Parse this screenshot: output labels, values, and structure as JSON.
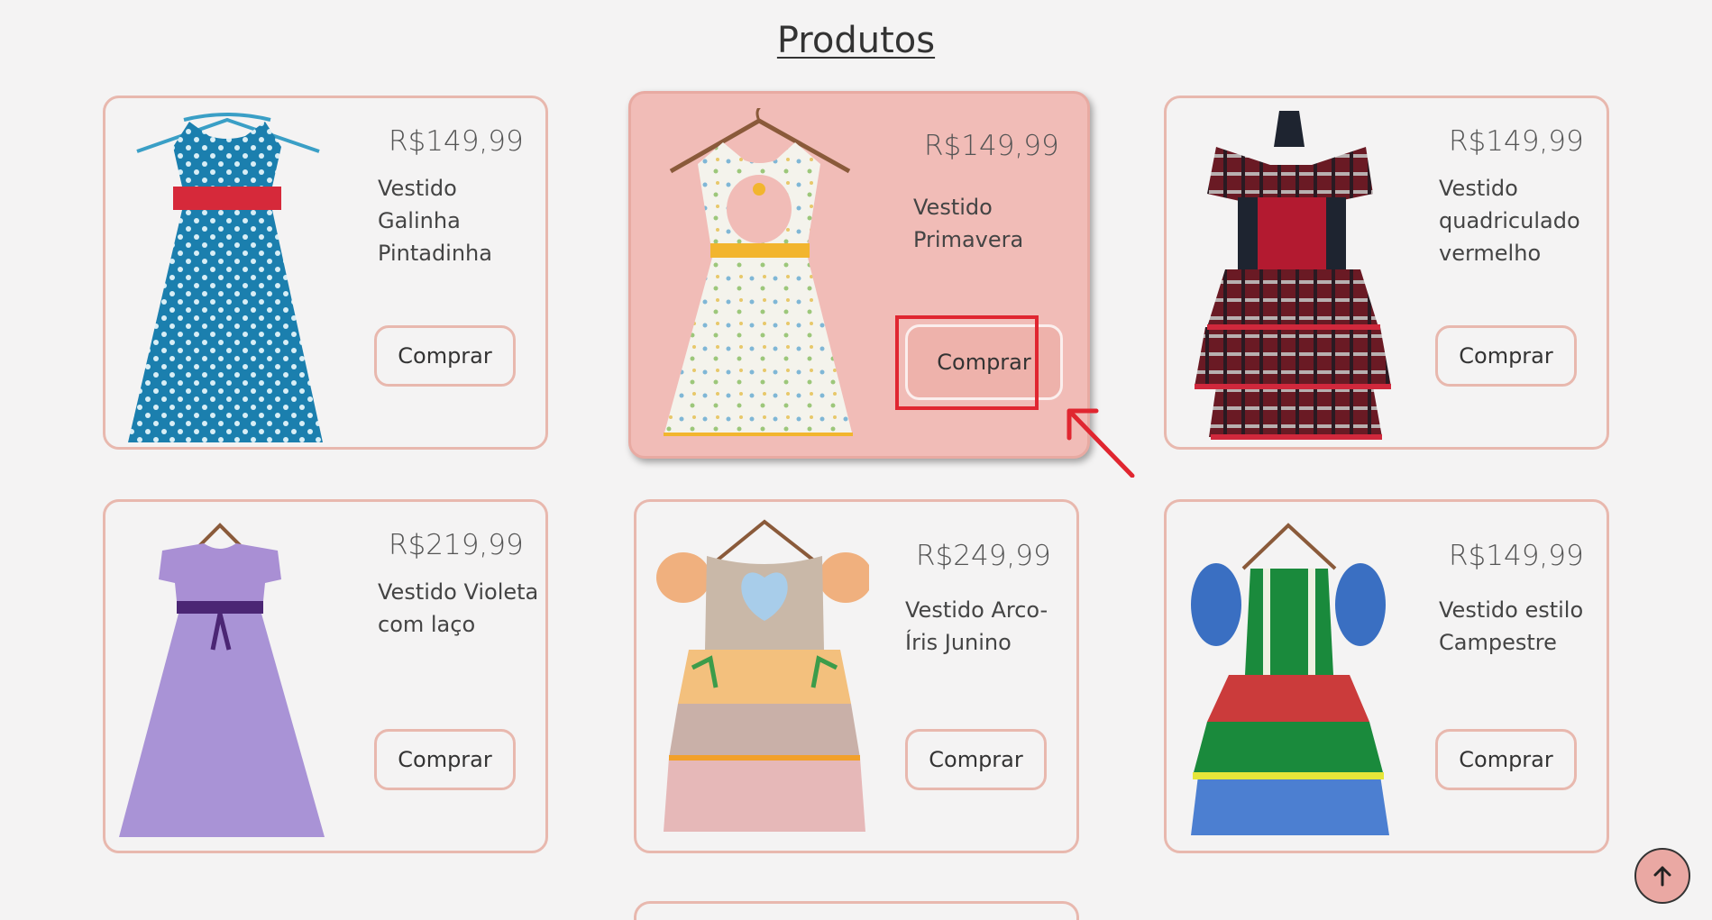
{
  "section": {
    "title": "Produtos"
  },
  "products": [
    {
      "price": "R$149,99",
      "name": "Vestido Galinha Pintadinha",
      "button": "Comprar"
    },
    {
      "price": "R$149,99",
      "name": "Vestido Primavera",
      "button": "Comprar"
    },
    {
      "price": "R$149,99",
      "name": "Vestido quadriculado vermelho",
      "button": "Comprar"
    },
    {
      "price": "R$219,99",
      "name": "Vestido Violeta com laço",
      "button": "Comprar"
    },
    {
      "price": "R$249,99",
      "name": "Vestido Arco-Íris Junino",
      "button": "Comprar"
    },
    {
      "price": "R$149,99",
      "name": "Vestido estilo Campestre",
      "button": "Comprar"
    }
  ],
  "colors": {
    "background": "#f4f3f3",
    "card_border": "#e8b8ae",
    "hover_card": "#f1bcb7",
    "highlight": "#e02630",
    "back_to_top": "#eaa8a3"
  },
  "icons": {
    "back_to_top": "arrow-up-icon",
    "annotation": "arrow-pointer-icon"
  }
}
